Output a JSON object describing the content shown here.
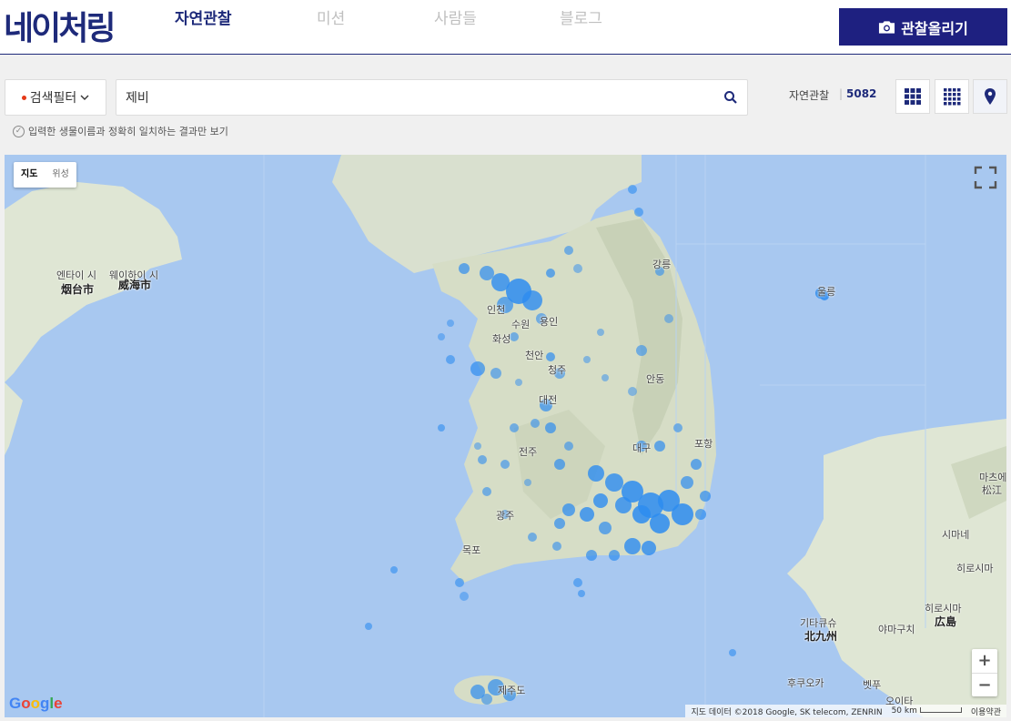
{
  "header": {
    "logo": "네이처링",
    "nav": [
      {
        "label": "자연관찰",
        "active": true
      },
      {
        "label": "미션",
        "active": false
      },
      {
        "label": "사람들",
        "active": false
      },
      {
        "label": "블로그",
        "active": false
      }
    ],
    "upload_label": "관찰올리기"
  },
  "search": {
    "filter_label": "검색필터",
    "query": "제비",
    "count_label": "자연관찰",
    "count_value": "5082",
    "exact_match_label": "입력한 생물이름과 정확히 일치하는 결과만 보기"
  },
  "view_modes": [
    {
      "name": "large-grid",
      "icon": "grid-large-icon",
      "active": false
    },
    {
      "name": "small-grid",
      "icon": "grid-small-icon",
      "active": false
    },
    {
      "name": "map",
      "icon": "map-pin-icon",
      "active": true
    }
  ],
  "map": {
    "type_map": "지도",
    "type_satellite": "위성",
    "zoom_in": "+",
    "zoom_out": "−",
    "google": "Google",
    "attribution": "지도 데이터 ©2018 Google, SK telecom, ZENRIN",
    "scale": "50 km",
    "terms": "이용약관",
    "labels": [
      {
        "text": "엔타이 시"
      },
      {
        "text": "웨이하이 시"
      },
      {
        "text": "烟台市"
      },
      {
        "text": "威海市"
      },
      {
        "text": "인천"
      },
      {
        "text": "수원"
      },
      {
        "text": "용인"
      },
      {
        "text": "강릉"
      },
      {
        "text": "화성"
      },
      {
        "text": "천안"
      },
      {
        "text": "청주"
      },
      {
        "text": "대전"
      },
      {
        "text": "안동"
      },
      {
        "text": "포항"
      },
      {
        "text": "대구"
      },
      {
        "text": "전주"
      },
      {
        "text": "광주"
      },
      {
        "text": "목포"
      },
      {
        "text": "울릉"
      },
      {
        "text": "제주도"
      },
      {
        "text": "기타큐슈"
      },
      {
        "text": "北九州"
      },
      {
        "text": "히로시마"
      },
      {
        "text": "広島"
      },
      {
        "text": "마츠에"
      },
      {
        "text": "松江"
      },
      {
        "text": "시마네"
      },
      {
        "text": "히로시마"
      },
      {
        "text": "야마구치"
      },
      {
        "text": "후쿠오카"
      },
      {
        "text": "오이타"
      },
      {
        "text": "벳푸"
      }
    ]
  },
  "colors": {
    "brand": "#1e2a7a",
    "button": "#1e2080",
    "marker": "#2d8cf0",
    "sea": "#a8c8f0"
  }
}
